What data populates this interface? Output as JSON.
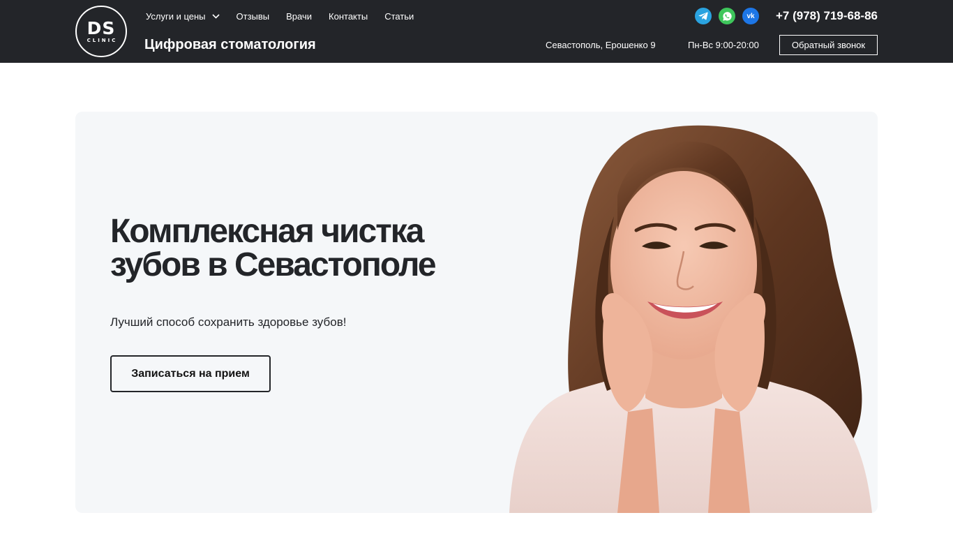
{
  "logo": {
    "main": "DS",
    "sub": "CLINIC"
  },
  "nav": {
    "items": [
      {
        "label": "Услуги и цены",
        "has_dropdown": true
      },
      {
        "label": "Отзывы"
      },
      {
        "label": "Врачи"
      },
      {
        "label": "Контакты"
      },
      {
        "label": "Статьи"
      }
    ]
  },
  "header": {
    "tagline": "Цифровая стоматология",
    "phone": "+7 (978) 719-68-86",
    "address": "Севастополь, Ерошенко 9",
    "hours": "Пн-Вс 9:00-20:00",
    "callback_label": "Обратный звонок",
    "socials": [
      {
        "name": "telegram-icon",
        "color": "#2aa3e0"
      },
      {
        "name": "whatsapp-icon",
        "color": "#3ec65b"
      },
      {
        "name": "vk-icon",
        "color": "#1d76e6",
        "glyph": "vk"
      }
    ]
  },
  "hero": {
    "title": "Комплексная чистка зубов в Севастополе",
    "subtitle": "Лучший способ сохранить здоровье зубов!",
    "button_label": "Записаться на прием"
  },
  "colors": {
    "header_bg": "#232529",
    "hero_bg": "#f5f7f9",
    "text_dark": "#232529"
  }
}
